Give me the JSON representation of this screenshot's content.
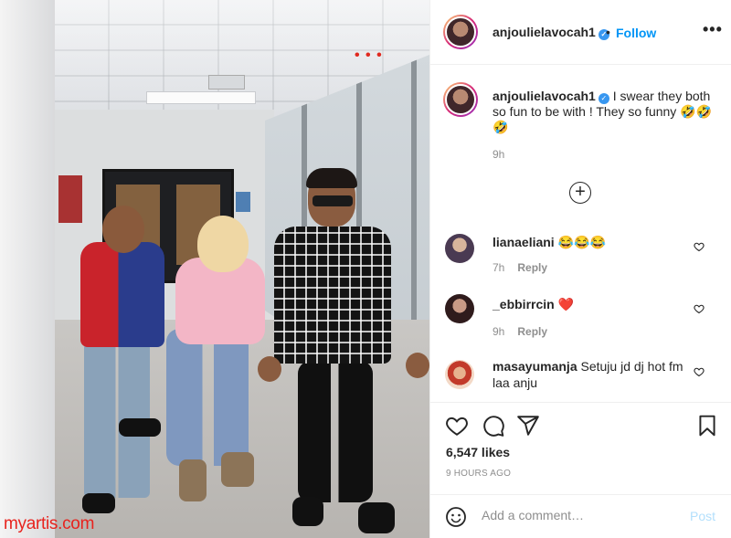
{
  "post": {
    "username": "anjoulielavocah1",
    "follow_label": "Follow",
    "separator": "•",
    "more_label": "•••",
    "verified_mark": "✓"
  },
  "caption": {
    "username": "anjoulielavocah1",
    "text": " I swear they both so fun to be with ! They so funny 🤣🤣🤣",
    "time": "9h"
  },
  "load_more_label": "+",
  "comments": [
    {
      "username": "lianaeliani",
      "text": " 😂😂😂",
      "time": "7h",
      "reply_label": "Reply"
    },
    {
      "username": "_ebbirrcin",
      "text": " ❤️",
      "time": "9h",
      "reply_label": "Reply"
    },
    {
      "username": "masayumanja",
      "text": " Setuju jd dj hot fm laa anju",
      "time": "",
      "reply_label": ""
    }
  ],
  "actions": {
    "likes": "6,547 likes",
    "posted": "9 HOURS AGO"
  },
  "add_comment": {
    "placeholder": "Add a comment…",
    "post_label": "Post"
  },
  "watermark": "myartis.com",
  "colors": {
    "accent": "#0095f6",
    "verified": "#3897f0",
    "post_disabled": "#b2dffc",
    "heart_red": "#ed4956",
    "watermark": "#e8231e"
  }
}
